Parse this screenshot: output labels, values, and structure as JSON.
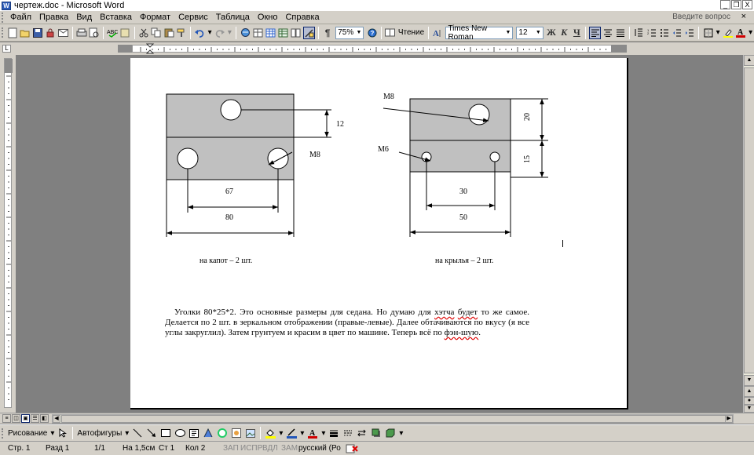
{
  "window": {
    "title": "чертеж.doc - Microsoft Word",
    "app_icon": "W",
    "controls": [
      "_",
      "❐",
      "X"
    ]
  },
  "menu": {
    "items": [
      "Файл",
      "Правка",
      "Вид",
      "Вставка",
      "Формат",
      "Сервис",
      "Таблица",
      "Окно",
      "Справка"
    ],
    "help_placeholder": "Введите вопрос",
    "close": "×"
  },
  "toolbar": {
    "zoom": "75%",
    "reading": "Чтение",
    "font_name": "Times New Roman",
    "font_size": "12",
    "bold": "Ж",
    "italic": "К",
    "underline": "Ч"
  },
  "drawing": {
    "left": {
      "dim_12": "12",
      "thread": "M8",
      "dim_67": "67",
      "dim_80": "80",
      "caption": "на капот – 2 шт."
    },
    "right": {
      "thread_top": "M8",
      "thread_bottom": "M6",
      "dim_20": "20",
      "dim_15": "15",
      "dim_30": "30",
      "dim_50": "50",
      "caption": "на крылья – 2 шт."
    }
  },
  "document": {
    "p1": "Уголки 80*25*2. Это основные размеры для седана. Но думаю для ",
    "w1": "хэтча",
    "p2": " ",
    "w2": "будет",
    "p3": " то же самое. Делается по 2 шт. в зеркальном отображении (правые-левые). Далее обтачиваются по вкусу (я все углы закруглил). Затем грунтуем и красим в цвет по машине. Теперь всё по ",
    "w3": "фэн-шую",
    "p4": "."
  },
  "drawbar": {
    "drawing": "Рисование",
    "autoshapes": "Автофигуры"
  },
  "status": {
    "page": "Стр. 1",
    "section": "Разд 1",
    "pages": "1/1",
    "at": "На 1,5см",
    "line": "Ст 1",
    "col": "Кол 2",
    "rec": "ЗАП",
    "trk": "ИСПР",
    "ext": "ВДЛ",
    "ovr": "ЗАМ",
    "language": "русский (Ро"
  },
  "colors": {
    "chrome": "#d4d0c8",
    "workspace": "#808080",
    "part_fill": "#c0c0c0",
    "font_color": "#d00000",
    "highlight": "#ffff00"
  }
}
